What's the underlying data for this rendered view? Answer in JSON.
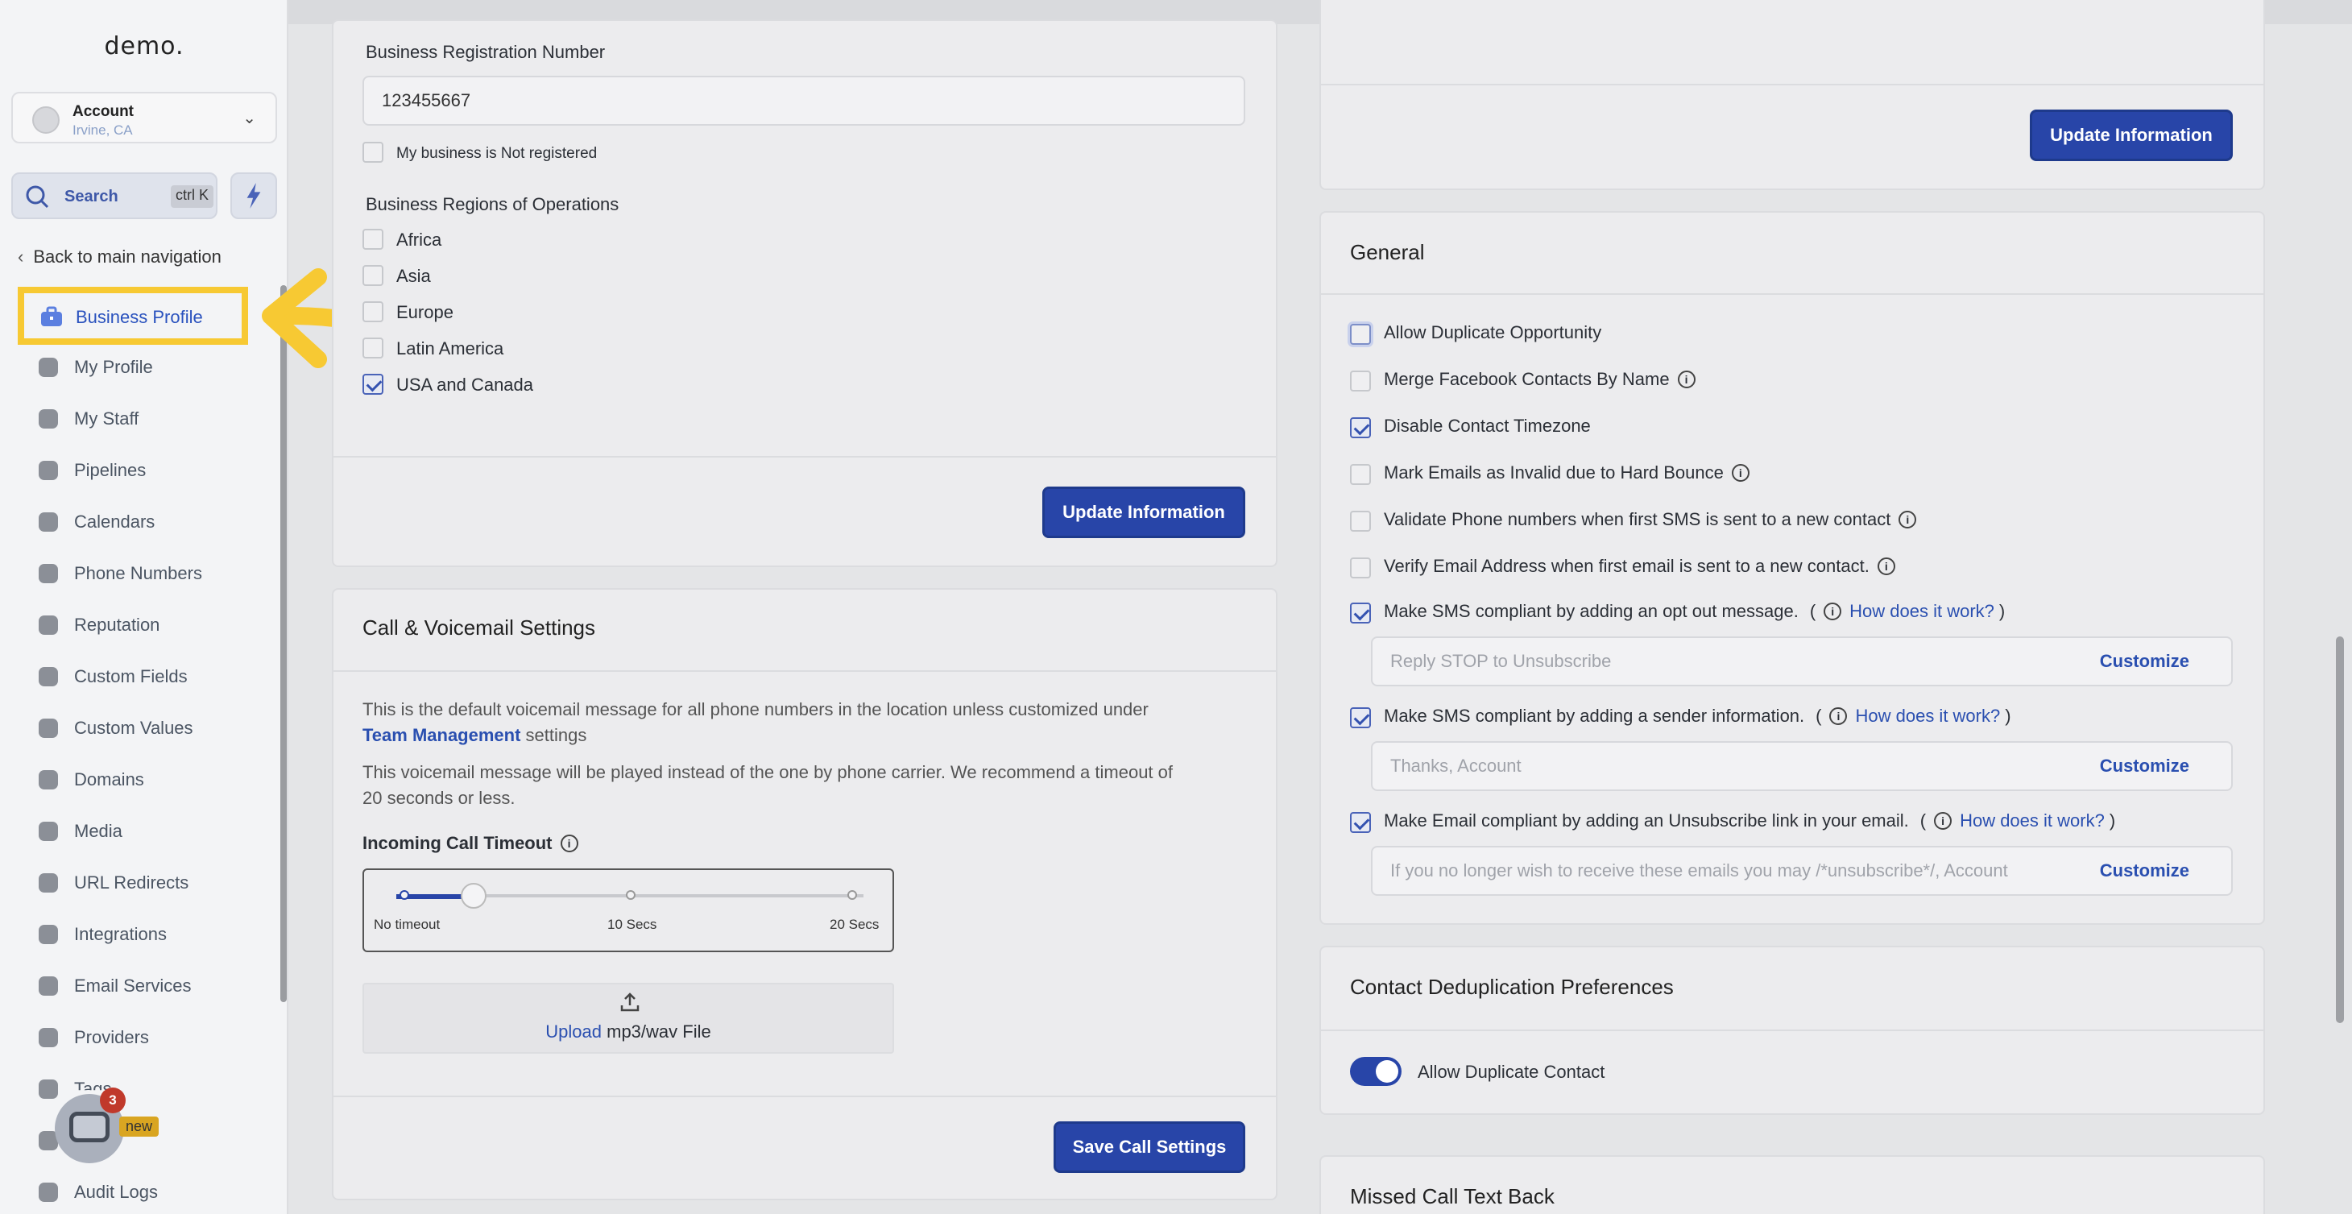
{
  "sidebar": {
    "logo": "demo.",
    "account": {
      "name": "Account",
      "location": "Irvine, CA"
    },
    "search": {
      "label": "Search",
      "shortcut": "ctrl K"
    },
    "back_label": "Back to main navigation",
    "active_item": "Business Profile",
    "items": [
      {
        "label": "My Profile",
        "icon": "user-circle-icon"
      },
      {
        "label": "My Staff",
        "icon": "person-icon"
      },
      {
        "label": "Pipelines",
        "icon": "funnel-icon"
      },
      {
        "label": "Calendars",
        "icon": "calendar-icon"
      },
      {
        "label": "Phone Numbers",
        "icon": "phone-icon"
      },
      {
        "label": "Reputation",
        "icon": "star-icon"
      },
      {
        "label": "Custom Fields",
        "icon": "fields-icon"
      },
      {
        "label": "Custom Values",
        "icon": "diamond-icon"
      },
      {
        "label": "Domains",
        "icon": "globe-icon"
      },
      {
        "label": "Media",
        "icon": "media-icon"
      },
      {
        "label": "URL Redirects",
        "icon": "redirect-icon"
      },
      {
        "label": "Integrations",
        "icon": "integrations-icon"
      },
      {
        "label": "Email Services",
        "icon": "mail-icon"
      },
      {
        "label": "Providers",
        "icon": "clipboard-icon"
      },
      {
        "label": "Tags",
        "icon": "tag-icon"
      },
      {
        "label": "",
        "icon": "labs-icon"
      },
      {
        "label": "Audit Logs",
        "icon": "bar-chart-icon"
      }
    ],
    "chat_badge": "3",
    "new_tag": "new"
  },
  "business": {
    "reg_label": "Business Registration Number",
    "reg_value": "123455667",
    "not_registered": "My business is Not registered",
    "regions_label": "Business Regions of Operations",
    "regions": [
      {
        "label": "Africa",
        "checked": false
      },
      {
        "label": "Asia",
        "checked": false
      },
      {
        "label": "Europe",
        "checked": false
      },
      {
        "label": "Latin America",
        "checked": false
      },
      {
        "label": "USA and Canada",
        "checked": true
      }
    ],
    "update_btn": "Update Information"
  },
  "call": {
    "title": "Call & Voicemail Settings",
    "desc1": "This is the default voicemail message for all phone numbers in the location unless customized under",
    "desc1_link": "Team Management",
    "desc1_tail": "settings",
    "desc2a": "This voicemail message will be played instead of the one by phone carrier. We recommend a timeout of",
    "desc2b": "20 seconds or less.",
    "timeout_label": "Incoming Call Timeout",
    "ticks": [
      "No timeout",
      "10 Secs",
      "20 Secs"
    ],
    "timeout_value_secs": 5,
    "upload_link": "Upload",
    "upload_text": "mp3/wav File",
    "save_btn": "Save Call Settings"
  },
  "right_top": {
    "update_btn": "Update Information"
  },
  "general": {
    "title": "General",
    "options": [
      {
        "label": "Allow Duplicate Opportunity",
        "checked": false,
        "info": false
      },
      {
        "label": "Merge Facebook Contacts By Name",
        "checked": false,
        "info": true
      },
      {
        "label": "Disable Contact Timezone",
        "checked": true,
        "info": false
      },
      {
        "label": "Mark Emails as Invalid due to Hard Bounce",
        "checked": false,
        "info": true
      },
      {
        "label": "Validate Phone numbers when first SMS is sent to a new contact",
        "checked": false,
        "info": true
      },
      {
        "label": "Verify Email Address when first email is sent to a new contact.",
        "checked": false,
        "info": true
      }
    ],
    "compliance": [
      {
        "label": "Make SMS compliant by adding an opt out message.",
        "link": "How does it work?",
        "placeholder": "Reply STOP to Unsubscribe",
        "customize": "Customize",
        "checked": true
      },
      {
        "label": "Make SMS compliant by adding a sender information.",
        "link": "How does it work?",
        "placeholder": "Thanks, Account",
        "customize": "Customize",
        "checked": true
      },
      {
        "label": "Make Email compliant by adding an Unsubscribe link in your email.",
        "link": "How does it work?",
        "placeholder": "If you no longer wish to receive these emails you may /*unsubscribe*/, Account",
        "customize": "Customize",
        "checked": true
      }
    ]
  },
  "dedup": {
    "title": "Contact Deduplication Preferences",
    "toggle_label": "Allow Duplicate Contact",
    "toggle_on": true
  },
  "missed": {
    "title": "Missed Call Text Back"
  }
}
